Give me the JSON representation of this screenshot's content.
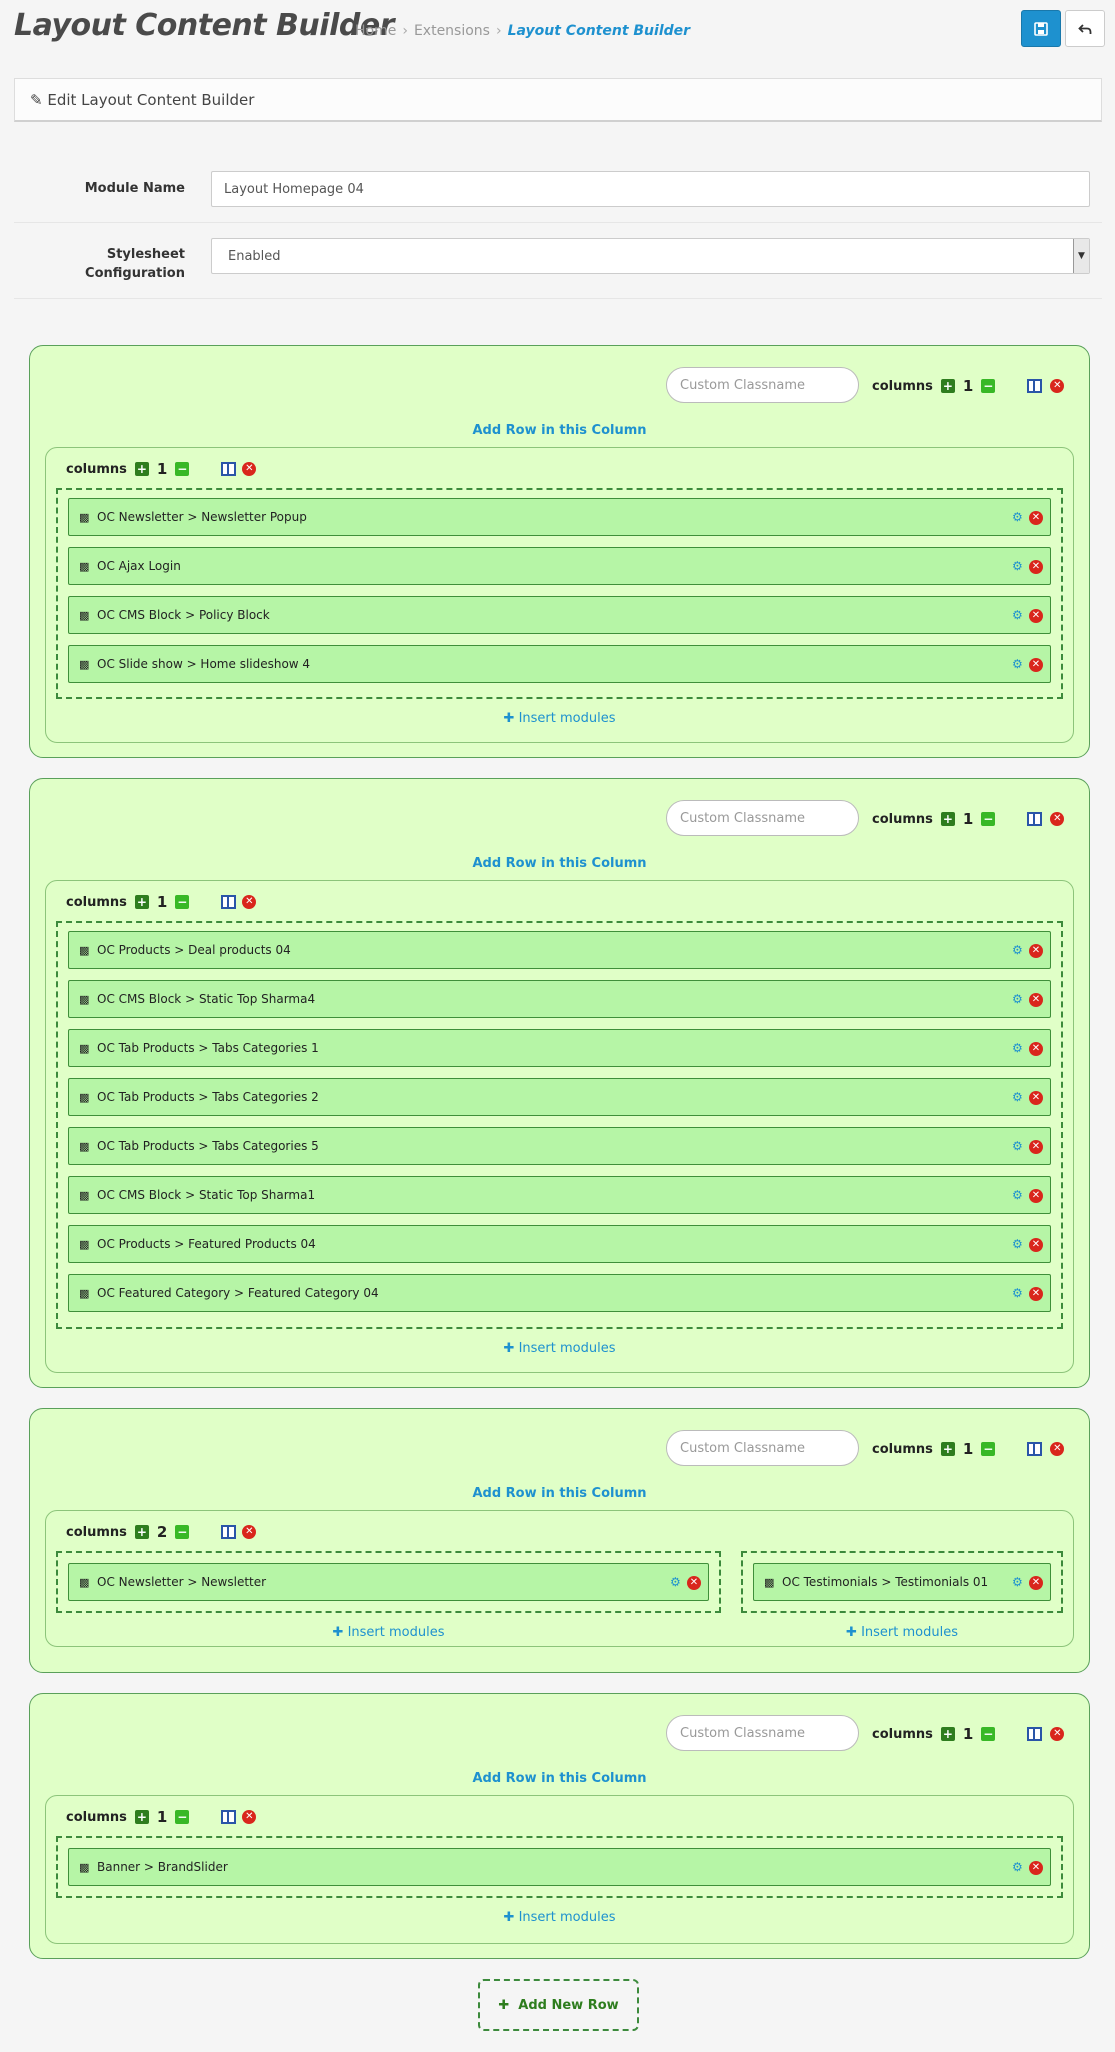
{
  "header": {
    "title": "Layout Content Builder",
    "breadcrumb": [
      "Home",
      "Extensions",
      "Layout Content Builder"
    ],
    "save_icon": "save-icon",
    "back_icon": "back-icon"
  },
  "panel": {
    "title": "Edit Layout Content Builder",
    "icon": "pencil-icon"
  },
  "form": {
    "module_name_label": "Module Name",
    "module_name_value": "Layout Homepage 04",
    "stylesheet_label_1": "Stylesheet",
    "stylesheet_label_2": "Configuration",
    "stylesheet_value": "Enabled"
  },
  "common": {
    "classname_placeholder": "Custom Classname",
    "columns_label": "columns",
    "add_row_label": "Add Row in this Column",
    "insert_label": "Insert modules",
    "add_new_row": "Add New Row"
  },
  "colors": {
    "accent": "#1e91cf",
    "row_bg": "#e0ffc7",
    "module_bg": "#b6f5a6",
    "danger": "#d9261c"
  },
  "rows": [
    {
      "columns": "1",
      "inner_columns": "1",
      "modules": [
        "OC Newsletter > Newsletter Popup",
        "OC Ajax Login",
        "OC CMS Block > Policy Block",
        "OC Slide show > Home slideshow 4"
      ]
    },
    {
      "columns": "1",
      "inner_columns": "1",
      "modules": [
        "OC Products > Deal products 04",
        "OC CMS Block > Static Top Sharma4",
        "OC Tab Products > Tabs Categories 1",
        "OC Tab Products > Tabs Categories 2",
        "OC Tab Products > Tabs Categories 5",
        "OC CMS Block > Static Top Sharma1",
        "OC Products > Featured Products 04",
        "OC Featured Category > Featured Category 04"
      ]
    },
    {
      "columns": "1",
      "inner_columns": "2",
      "modules_left": [
        "OC Newsletter > Newsletter"
      ],
      "modules_right": [
        "OC Testimonials > Testimonials 01"
      ]
    },
    {
      "columns": "1",
      "inner_columns": "1",
      "modules": [
        "Banner > BrandSlider"
      ]
    }
  ]
}
